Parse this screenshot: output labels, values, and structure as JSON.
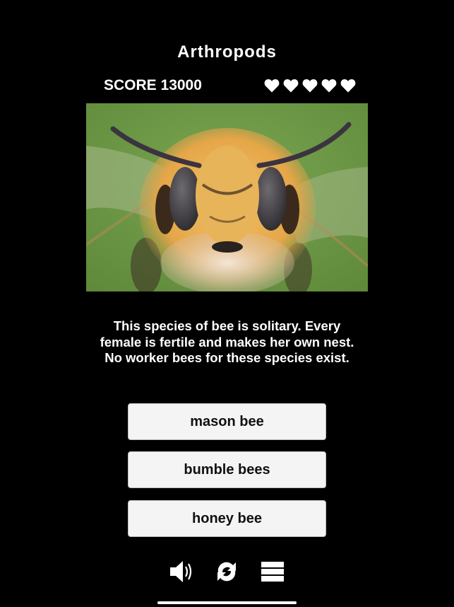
{
  "header": {
    "title": "Arthropods",
    "score_label": "SCORE 13000",
    "score": 13000,
    "lives": 5,
    "lives_max": 5
  },
  "question": {
    "image": "photo of a solitary bee face close-up on green background",
    "text": "This species of bee is solitary. Every female is fertile and makes her own nest. No worker bees for these species exist."
  },
  "answers": [
    {
      "label": "mason bee"
    },
    {
      "label": "bumble bees"
    },
    {
      "label": "honey bee"
    }
  ],
  "toolbar": {
    "sound_icon": "speaker-icon",
    "restart_icon": "refresh-icon",
    "menu_icon": "menu-icon"
  },
  "colors": {
    "background": "#000000",
    "text": "#ffffff",
    "button_bg": "#f4f4f4",
    "button_text": "#111111"
  }
}
